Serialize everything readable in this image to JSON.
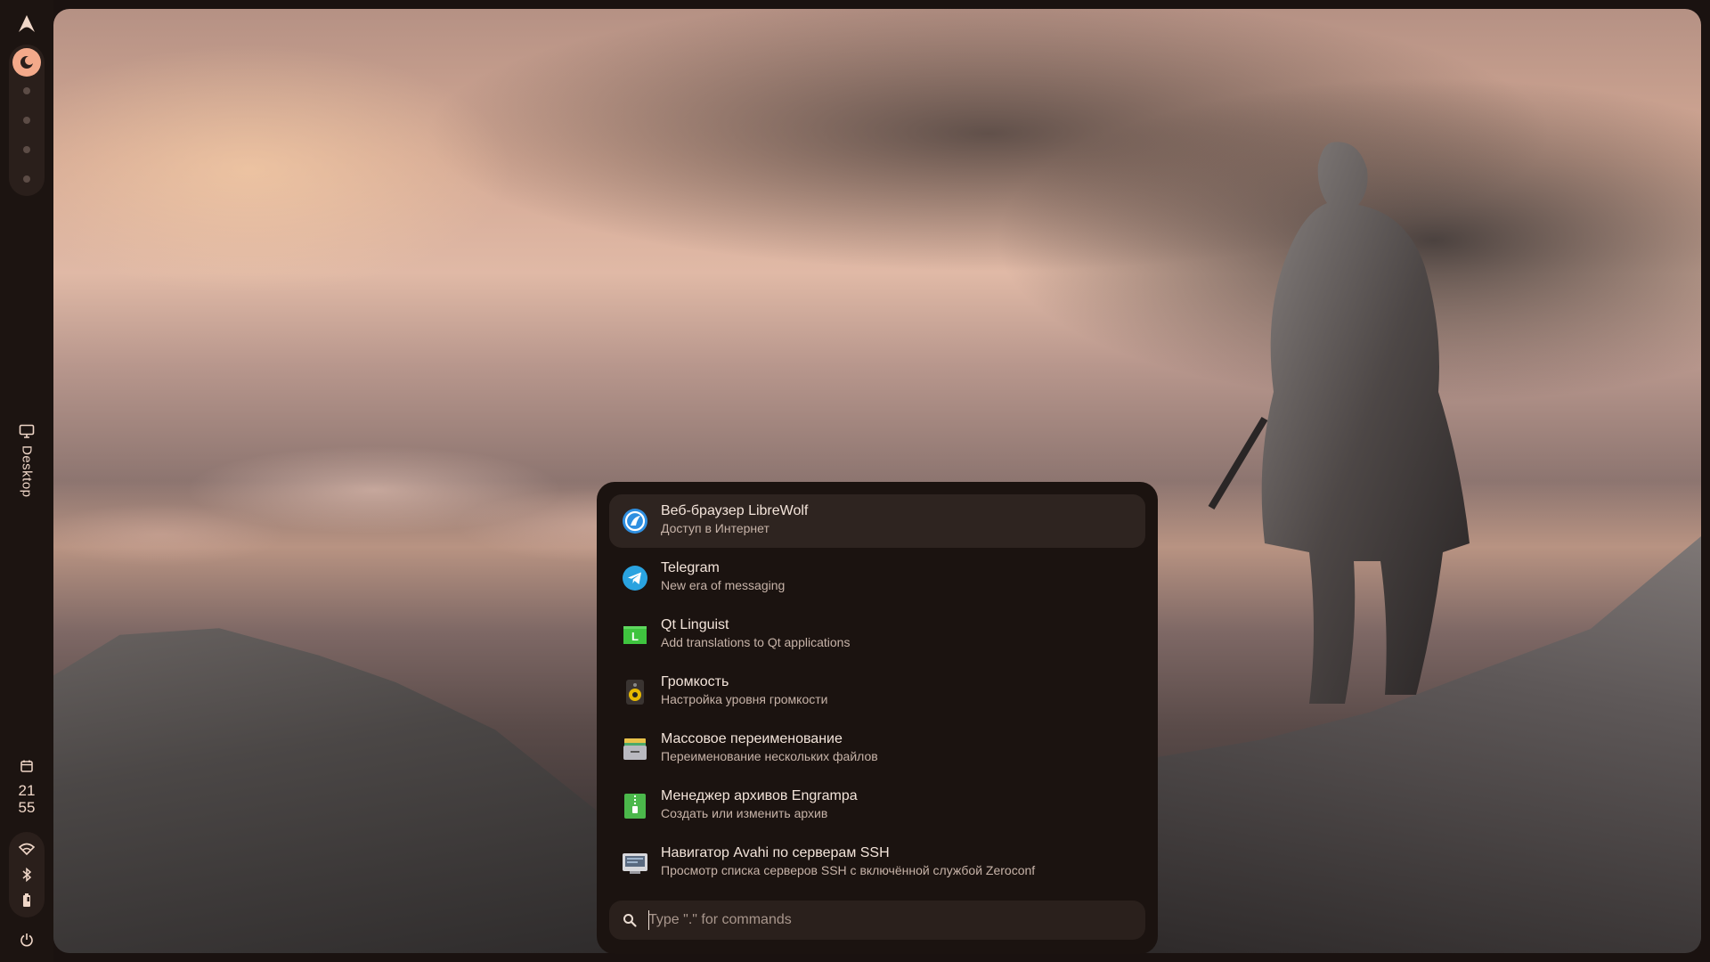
{
  "bar": {
    "desktop_label": "Desktop",
    "clock": {
      "hour": "21",
      "minute": "55"
    }
  },
  "colors": {
    "accent": "#f3a98a",
    "bar_bg": "#1c1411",
    "launcher_bg": "#1b1310",
    "active_row": "#2e2420"
  },
  "launcher": {
    "apps": [
      {
        "name": "Веб-браузер LibreWolf",
        "description": "Доступ в Интернет",
        "icon": "librewolf-icon",
        "active": true
      },
      {
        "name": "Telegram",
        "description": "New era of messaging",
        "icon": "telegram-icon"
      },
      {
        "name": "Qt Linguist",
        "description": "Add translations to Qt applications",
        "icon": "qt-linguist-icon"
      },
      {
        "name": "Громкость",
        "description": "Настройка уровня громкости",
        "icon": "volume-speaker-icon"
      },
      {
        "name": "Массовое переименование",
        "description": "Переименование нескольких файлов",
        "icon": "bulk-rename-icon"
      },
      {
        "name": "Менеджер архивов Engrampa",
        "description": "Создать или изменить архив",
        "icon": "archive-manager-icon"
      },
      {
        "name": "Навигатор Avahi по серверам SSH",
        "description": "Просмотр списка серверов SSH с включённой службой Zeroconf",
        "icon": "ssh-network-icon"
      }
    ],
    "search": {
      "value": "",
      "placeholder": "Type \".\" for commands"
    }
  }
}
